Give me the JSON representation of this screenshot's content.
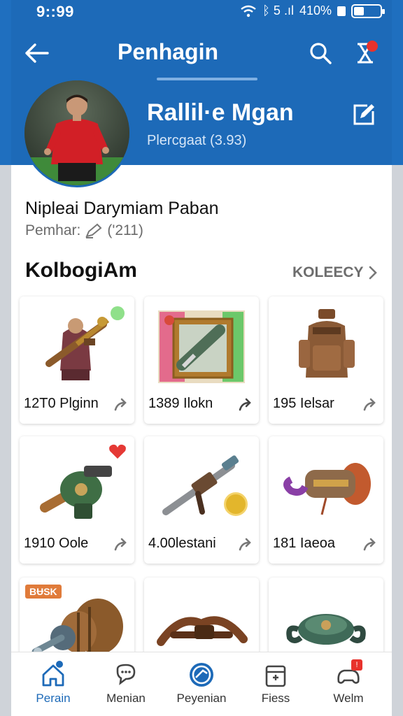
{
  "status_bar": {
    "time": "9::99",
    "network": "ᛒ 5 .ıl",
    "battery_text": "410%"
  },
  "top_bar": {
    "title": "Penhagin"
  },
  "profile": {
    "name": "Rallil·e Mgan",
    "subtitle": "Plercgaat (3.93)",
    "full_name": "Nipleai Darymiam Paban",
    "meta_label": "Pemhar:",
    "meta_value": "('211)"
  },
  "section": {
    "title": "KolbogiAm",
    "link": "KOLEECY"
  },
  "items": [
    {
      "label": "12T0  Plginn",
      "icon": "warrior-gun-icon"
    },
    {
      "label": "1389  Ilokn",
      "icon": "trading-card-icon"
    },
    {
      "label": "195  Ielsar",
      "icon": "backpack-icon"
    },
    {
      "label": "1910  Oole",
      "icon": "green-blaster-icon"
    },
    {
      "label": "4.00lestani",
      "icon": "rifle-icon"
    },
    {
      "label": "181  Iaeoa",
      "icon": "purple-cannon-icon"
    },
    {
      "label": "",
      "icon": "barrel-cannon-icon",
      "tag": "BɄSK"
    },
    {
      "label": "",
      "icon": "wooden-crossbow-icon"
    },
    {
      "label": "",
      "icon": "armored-disc-icon"
    }
  ],
  "bottom_nav": [
    {
      "label": "Perain",
      "icon": "home-icon",
      "active": true
    },
    {
      "label": "Menian",
      "icon": "chat-icon",
      "active": false
    },
    {
      "label": "Peyenian",
      "icon": "globe-icon",
      "active": false
    },
    {
      "label": "Fiess",
      "icon": "box-icon",
      "active": false
    },
    {
      "label": "Welm",
      "icon": "gamepad-icon",
      "active": false
    }
  ],
  "colors": {
    "header_blue": "#1d6ab8",
    "accent_red": "#e8322c",
    "text_dark": "#111111"
  }
}
